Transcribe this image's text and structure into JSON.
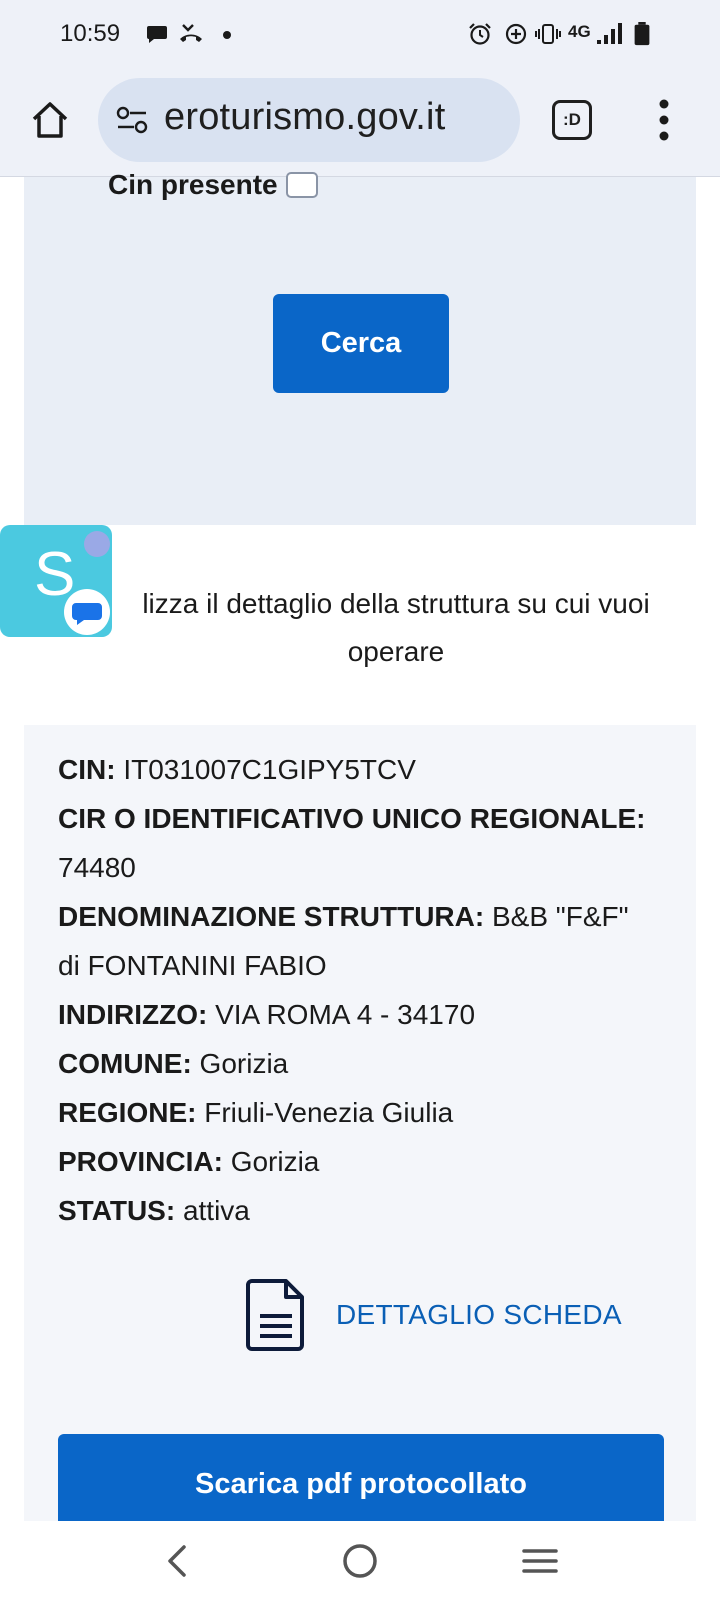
{
  "status_bar": {
    "time": "10:59",
    "network": "4G",
    "icons": [
      "chat-icon",
      "missed-call-icon",
      "dot-icon",
      "alarm-icon",
      "data-saver-icon",
      "vibrate-icon",
      "signal-icon",
      "battery-icon"
    ]
  },
  "browser": {
    "url": "eroturismo.gov.it",
    "tab_label": ":D",
    "icons": [
      "home-icon",
      "site-settings-icon",
      "more-vert-icon"
    ]
  },
  "search_panel": {
    "cin_presente_label": "Cin presente",
    "cin_presente_checked": false,
    "search_button": "Cerca"
  },
  "floating_bubble": {
    "letter": "S"
  },
  "instruction": {
    "line1": "lizza il dettaglio della struttura su cui vuoi",
    "line2": "operare"
  },
  "result": {
    "cin_label": "CIN:",
    "cin_value": "IT031007C1GIPY5TCV",
    "cir_label": "CIR O IDENTIFICATIVO UNICO REGIONALE:",
    "cir_value": "74480",
    "denominazione_label": "DENOMINAZIONE STRUTTURA:",
    "denominazione_value_1": "B&B \"F&F\"",
    "denominazione_value_2": "di FONTANINI FABIO",
    "indirizzo_label": "INDIRIZZO:",
    "indirizzo_value": "VIA ROMA 4 - 34170",
    "comune_label": "COMUNE:",
    "comune_value": "Gorizia",
    "regione_label": "REGIONE:",
    "regione_value": "Friuli-Venezia Giulia",
    "provincia_label": "PROVINCIA:",
    "provincia_value": "Gorizia",
    "status_label": "STATUS:",
    "status_value": "attiva",
    "detail_link": "DETTAGLIO SCHEDA",
    "pdf_button": "Scarica pdf protocollato"
  },
  "nav_bar": {
    "icons": [
      "back-icon",
      "home-circle-icon",
      "recents-icon"
    ]
  },
  "colors": {
    "primary": "#0a66c8",
    "link": "#0a5fb5",
    "panel": "#e9eef6",
    "card": "#f4f6fa",
    "chrome": "#eef1f8"
  }
}
